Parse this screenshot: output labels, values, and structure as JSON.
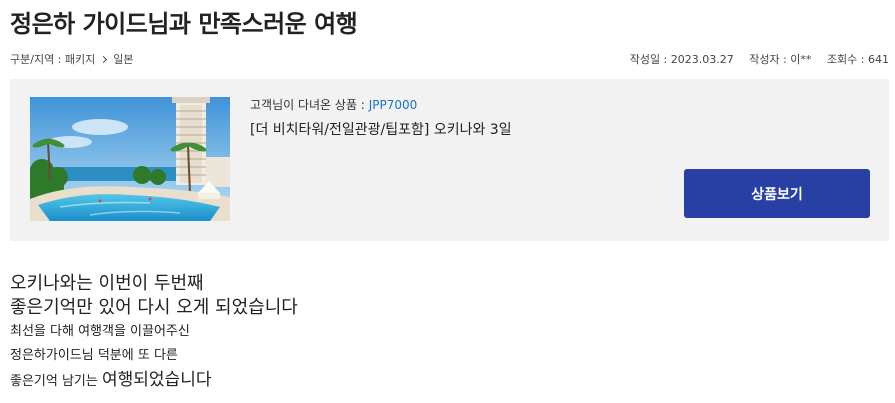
{
  "page_title": "정은하 가이드님과 만족스러운 여행",
  "breadcrumb": {
    "category": "구분/지역 : 패키지",
    "region": "일본"
  },
  "meta": {
    "date": "작성일 : 2023.03.27",
    "author": "작성자 : 이**",
    "views": "조회수 : 641"
  },
  "product": {
    "label": "고객님이 다녀온 상품 :",
    "code": "JPP7000",
    "name": "[더 비치타워/전일관광/팁포함] 오키나와 3일",
    "button_label": "상품보기"
  },
  "review": {
    "line1": "오키나와는 이번이 두번째",
    "line2": "좋은기억만 있어 다시 오게 되었습니다",
    "line3": "최선을 다해  여행객을 이끌어주신",
    "line4": "정은하가이드님 덕분에 또 다른",
    "line5_part1": "좋은기억 남기는 ",
    "line5_part2": "여행되었습니다"
  }
}
